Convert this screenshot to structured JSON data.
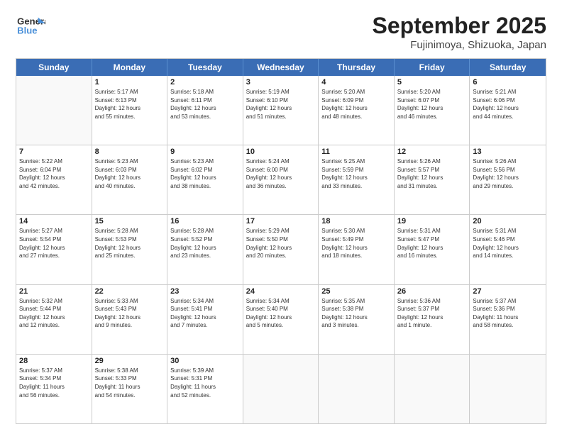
{
  "logo": {
    "line1": "General",
    "line2": "Blue"
  },
  "title": "September 2025",
  "subtitle": "Fujinimoya, Shizuoka, Japan",
  "header": {
    "days": [
      "Sunday",
      "Monday",
      "Tuesday",
      "Wednesday",
      "Thursday",
      "Friday",
      "Saturday"
    ]
  },
  "weeks": [
    [
      {
        "day": "",
        "info": ""
      },
      {
        "day": "1",
        "info": "Sunrise: 5:17 AM\nSunset: 6:13 PM\nDaylight: 12 hours\nand 55 minutes."
      },
      {
        "day": "2",
        "info": "Sunrise: 5:18 AM\nSunset: 6:11 PM\nDaylight: 12 hours\nand 53 minutes."
      },
      {
        "day": "3",
        "info": "Sunrise: 5:19 AM\nSunset: 6:10 PM\nDaylight: 12 hours\nand 51 minutes."
      },
      {
        "day": "4",
        "info": "Sunrise: 5:20 AM\nSunset: 6:09 PM\nDaylight: 12 hours\nand 48 minutes."
      },
      {
        "day": "5",
        "info": "Sunrise: 5:20 AM\nSunset: 6:07 PM\nDaylight: 12 hours\nand 46 minutes."
      },
      {
        "day": "6",
        "info": "Sunrise: 5:21 AM\nSunset: 6:06 PM\nDaylight: 12 hours\nand 44 minutes."
      }
    ],
    [
      {
        "day": "7",
        "info": "Sunrise: 5:22 AM\nSunset: 6:04 PM\nDaylight: 12 hours\nand 42 minutes."
      },
      {
        "day": "8",
        "info": "Sunrise: 5:23 AM\nSunset: 6:03 PM\nDaylight: 12 hours\nand 40 minutes."
      },
      {
        "day": "9",
        "info": "Sunrise: 5:23 AM\nSunset: 6:02 PM\nDaylight: 12 hours\nand 38 minutes."
      },
      {
        "day": "10",
        "info": "Sunrise: 5:24 AM\nSunset: 6:00 PM\nDaylight: 12 hours\nand 36 minutes."
      },
      {
        "day": "11",
        "info": "Sunrise: 5:25 AM\nSunset: 5:59 PM\nDaylight: 12 hours\nand 33 minutes."
      },
      {
        "day": "12",
        "info": "Sunrise: 5:26 AM\nSunset: 5:57 PM\nDaylight: 12 hours\nand 31 minutes."
      },
      {
        "day": "13",
        "info": "Sunrise: 5:26 AM\nSunset: 5:56 PM\nDaylight: 12 hours\nand 29 minutes."
      }
    ],
    [
      {
        "day": "14",
        "info": "Sunrise: 5:27 AM\nSunset: 5:54 PM\nDaylight: 12 hours\nand 27 minutes."
      },
      {
        "day": "15",
        "info": "Sunrise: 5:28 AM\nSunset: 5:53 PM\nDaylight: 12 hours\nand 25 minutes."
      },
      {
        "day": "16",
        "info": "Sunrise: 5:28 AM\nSunset: 5:52 PM\nDaylight: 12 hours\nand 23 minutes."
      },
      {
        "day": "17",
        "info": "Sunrise: 5:29 AM\nSunset: 5:50 PM\nDaylight: 12 hours\nand 20 minutes."
      },
      {
        "day": "18",
        "info": "Sunrise: 5:30 AM\nSunset: 5:49 PM\nDaylight: 12 hours\nand 18 minutes."
      },
      {
        "day": "19",
        "info": "Sunrise: 5:31 AM\nSunset: 5:47 PM\nDaylight: 12 hours\nand 16 minutes."
      },
      {
        "day": "20",
        "info": "Sunrise: 5:31 AM\nSunset: 5:46 PM\nDaylight: 12 hours\nand 14 minutes."
      }
    ],
    [
      {
        "day": "21",
        "info": "Sunrise: 5:32 AM\nSunset: 5:44 PM\nDaylight: 12 hours\nand 12 minutes."
      },
      {
        "day": "22",
        "info": "Sunrise: 5:33 AM\nSunset: 5:43 PM\nDaylight: 12 hours\nand 9 minutes."
      },
      {
        "day": "23",
        "info": "Sunrise: 5:34 AM\nSunset: 5:41 PM\nDaylight: 12 hours\nand 7 minutes."
      },
      {
        "day": "24",
        "info": "Sunrise: 5:34 AM\nSunset: 5:40 PM\nDaylight: 12 hours\nand 5 minutes."
      },
      {
        "day": "25",
        "info": "Sunrise: 5:35 AM\nSunset: 5:38 PM\nDaylight: 12 hours\nand 3 minutes."
      },
      {
        "day": "26",
        "info": "Sunrise: 5:36 AM\nSunset: 5:37 PM\nDaylight: 12 hours\nand 1 minute."
      },
      {
        "day": "27",
        "info": "Sunrise: 5:37 AM\nSunset: 5:36 PM\nDaylight: 11 hours\nand 58 minutes."
      }
    ],
    [
      {
        "day": "28",
        "info": "Sunrise: 5:37 AM\nSunset: 5:34 PM\nDaylight: 11 hours\nand 56 minutes."
      },
      {
        "day": "29",
        "info": "Sunrise: 5:38 AM\nSunset: 5:33 PM\nDaylight: 11 hours\nand 54 minutes."
      },
      {
        "day": "30",
        "info": "Sunrise: 5:39 AM\nSunset: 5:31 PM\nDaylight: 11 hours\nand 52 minutes."
      },
      {
        "day": "",
        "info": ""
      },
      {
        "day": "",
        "info": ""
      },
      {
        "day": "",
        "info": ""
      },
      {
        "day": "",
        "info": ""
      }
    ]
  ]
}
